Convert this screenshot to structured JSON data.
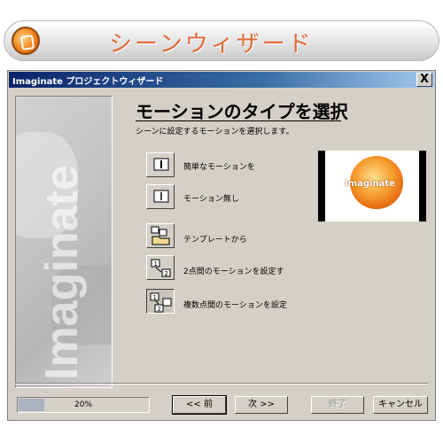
{
  "banner": {
    "title": "シーンウィザード",
    "icon": "app-logo-icon"
  },
  "dialog": {
    "title": "Imaginate プロジェクトウィザード",
    "close_label": "X",
    "side_text": "Imaginate",
    "heading": "モーションのタイプを選択",
    "subtext": "シーンに設定するモーションを選択します。",
    "options": [
      {
        "label": "簡単なモーションを",
        "icon": "simple-motion-icon"
      },
      {
        "label": "モーション無し",
        "icon": "no-motion-icon"
      },
      {
        "label": "テンプレートから",
        "icon": "template-icon"
      },
      {
        "label": "2点間のモーションを設定す",
        "icon": "two-point-motion-icon"
      },
      {
        "label": "複数点間のモーションを設定",
        "icon": "multi-point-motion-icon"
      }
    ],
    "selected_option_index": 4,
    "preview": {
      "text": "Imaginate"
    },
    "progress": {
      "value": 0.2,
      "label": "20%"
    },
    "buttons": {
      "back": "<< 前",
      "next": "次 >>",
      "finish": "終了",
      "cancel": "キャンセル"
    }
  }
}
